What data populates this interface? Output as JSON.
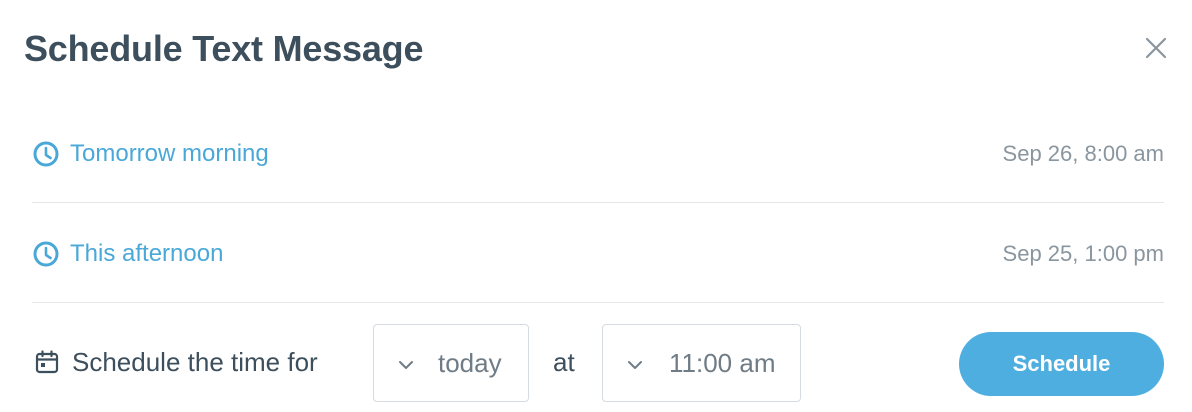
{
  "modal": {
    "title": "Schedule Text Message"
  },
  "options": [
    {
      "label": "Tomorrow morning",
      "time": "Sep 26, 8:00 am",
      "icon": "clock-icon"
    },
    {
      "label": "This afternoon",
      "time": "Sep 25, 1:00 pm",
      "icon": "clock-icon"
    }
  ],
  "custom": {
    "icon": "calendar-icon",
    "label": "Schedule the time for",
    "date_value": "today",
    "at_label": "at",
    "time_value": "11:00 am",
    "button_label": "Schedule"
  },
  "colors": {
    "title": "#3d4f5c",
    "accent": "#4aa8d8",
    "button": "#4faee0",
    "muted": "#8a969f"
  }
}
